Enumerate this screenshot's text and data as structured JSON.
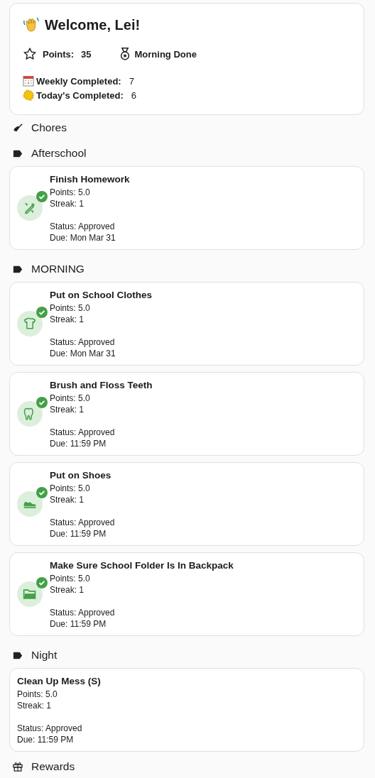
{
  "welcome": {
    "title": "Welcome, Lei!",
    "points_label": "Points:",
    "points_value": "35",
    "badge": "Morning Done",
    "weekly_label": "Weekly Completed:",
    "weekly_value": "7",
    "today_label": "Today's Completed:",
    "today_value": "6"
  },
  "chores_heading": "Chores",
  "groups": [
    {
      "label": "Afterschool",
      "chores": [
        {
          "title": "Finish Homework",
          "kind": "homework",
          "approved": true,
          "points": "Points: 5.0",
          "streak": "Streak: 1",
          "status": "Status: Approved",
          "due": "Due: Mon Mar 31"
        }
      ]
    },
    {
      "label": "MORNING",
      "chores": [
        {
          "title": "Put on School Clothes",
          "kind": "shirt",
          "approved": true,
          "points": "Points: 5.0",
          "streak": "Streak: 1",
          "status": "Status: Approved",
          "due": "Due: Mon Mar 31"
        },
        {
          "title": "Brush and Floss Teeth",
          "kind": "tooth",
          "approved": true,
          "points": "Points: 5.0",
          "streak": "Streak: 1",
          "status": "Status: Approved",
          "due": "Due: 11:59 PM"
        },
        {
          "title": "Put on Shoes",
          "kind": "shoe",
          "approved": true,
          "points": "Points: 5.0",
          "streak": "Streak: 1",
          "status": "Status: Approved",
          "due": "Due: 11:59 PM"
        },
        {
          "title": "Make Sure School Folder Is In Backpack",
          "kind": "folder",
          "approved": true,
          "points": "Points: 5.0",
          "streak": "Streak: 1",
          "status": "Status: Approved",
          "due": "Due: 11:59 PM"
        }
      ]
    },
    {
      "label": "Night",
      "chores": [
        {
          "title": "Clean Up Mess (S)",
          "points": "Points: 5.0",
          "streak": "Streak: 1",
          "status": "Status: Approved",
          "due": "Due: 11:59 PM"
        }
      ]
    }
  ],
  "rewards_heading": "Rewards"
}
